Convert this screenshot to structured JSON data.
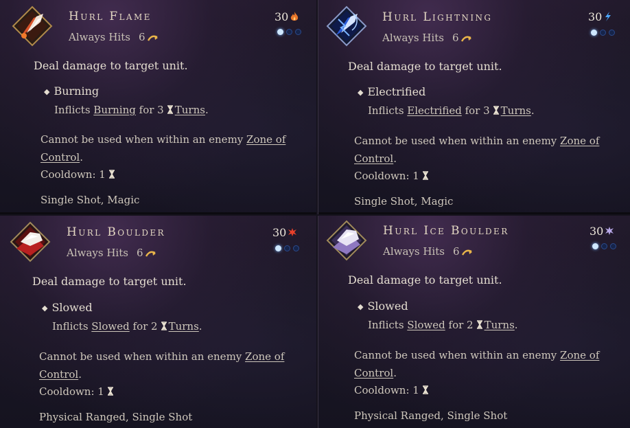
{
  "cards": [
    {
      "title": "Hurl Flame",
      "hits_label": "Always Hits",
      "range": "6",
      "cost": "30",
      "cost_icon": "flame-icon",
      "description": "Deal damage to target unit.",
      "effect_name": "Burning",
      "effect_pre": "Inflicts",
      "effect_status": "Burning",
      "effect_for": "for 3",
      "effect_turns": "Turns",
      "effect_end": ".",
      "zoc_pre": "Cannot be used when within an enemy",
      "zoc_link1": "Zone of",
      "zoc_link2": "Control",
      "cooldown": "Cooldown: 1",
      "tags": "Single Shot, Magic",
      "accent": "#e0622a"
    },
    {
      "title": "Hurl Lightning",
      "hits_label": "Always Hits",
      "range": "6",
      "cost": "30",
      "cost_icon": "lightning-icon",
      "description": "Deal damage to target unit.",
      "effect_name": "Electrified",
      "effect_pre": "Inflicts",
      "effect_status": "Electrified",
      "effect_for": "for 3",
      "effect_turns": "Turns",
      "effect_end": ".",
      "zoc_pre": "Cannot be used when within an enemy",
      "zoc_link1": "Zone of",
      "zoc_link2": "Control",
      "cooldown": "Cooldown: 1",
      "tags": "Single Shot, Magic",
      "accent": "#4c8cff"
    },
    {
      "title": "Hurl Boulder",
      "hits_label": "Always Hits",
      "range": "6",
      "cost": "30",
      "cost_icon": "burst-icon",
      "description": "Deal damage to target unit.",
      "effect_name": "Slowed",
      "effect_pre": "Inflicts",
      "effect_status": "Slowed",
      "effect_for": "for 2",
      "effect_turns": "Turns",
      "effect_end": ".",
      "zoc_pre": "Cannot be used when within an enemy",
      "zoc_link1": "Zone of",
      "zoc_link2": "Control",
      "cooldown": "Cooldown: 1",
      "tags": "Physical Ranged, Single Shot",
      "accent": "#c42a2a"
    },
    {
      "title": "Hurl Ice Boulder",
      "hits_label": "Always Hits",
      "range": "6",
      "cost": "30",
      "cost_icon": "frost-burst-icon",
      "description": "Deal damage to target unit.",
      "effect_name": "Slowed",
      "effect_pre": "Inflicts",
      "effect_status": "Slowed",
      "effect_for": "for 2",
      "effect_turns": "Turns",
      "effect_end": ".",
      "zoc_pre": "Cannot be used when within an enemy",
      "zoc_link1": "Zone of",
      "zoc_link2": "Control",
      "cooldown": "Cooldown: 1",
      "tags": "Physical Ranged, Single Shot",
      "accent": "#9a86c8"
    }
  ],
  "action_points": {
    "filled": 1,
    "total": 3
  }
}
